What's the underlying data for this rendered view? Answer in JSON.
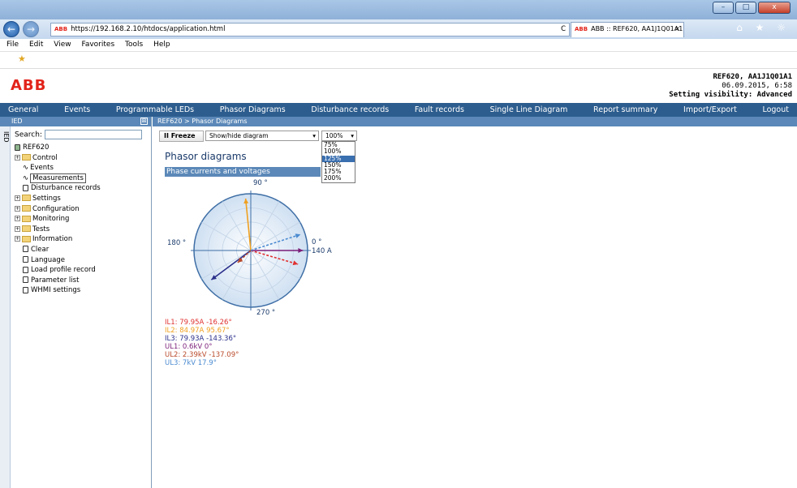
{
  "browser": {
    "url": "https://192.168.2.10/htdocs/application.html",
    "tab_title": "ABB :: REF620, AA1J1Q01A1...",
    "tab_close": "×",
    "win_minimize": "–",
    "win_restore": "□",
    "win_close": "x",
    "abb_badge": "ABB",
    "back": "←",
    "forward": "→",
    "refresh": "C",
    "menus": [
      "File",
      "Edit",
      "View",
      "Favorites",
      "Tools",
      "Help"
    ],
    "toolbar_icons": "⌂ ★ ☼",
    "favorites_star": "★"
  },
  "header": {
    "logo": "ABB",
    "device": "REF620, AA1J1Q01A1",
    "datetime": "06.09.2015, 6:58",
    "visibility": "Setting visibility: Advanced"
  },
  "nav": [
    "General",
    "Events",
    "Programmable LEDs",
    "Phasor Diagrams",
    "Disturbance records",
    "Fault records",
    "Single Line Diagram",
    "Report summary",
    "Import/Export",
    "Logout"
  ],
  "sidebar": {
    "header": "IED",
    "vertical_tab": "IED",
    "search_label": "Search:",
    "search_value": "",
    "collapse": "⊠",
    "tree": [
      {
        "label": "REF620",
        "kind": "root"
      },
      {
        "label": "Control",
        "kind": "folder"
      },
      {
        "label": "Events",
        "kind": "wave"
      },
      {
        "label": "Measurements",
        "kind": "wave-selected"
      },
      {
        "label": "Disturbance records",
        "kind": "leaf"
      },
      {
        "label": "Settings",
        "kind": "folder"
      },
      {
        "label": "Configuration",
        "kind": "folder"
      },
      {
        "label": "Monitoring",
        "kind": "folder"
      },
      {
        "label": "Tests",
        "kind": "folder"
      },
      {
        "label": "Information",
        "kind": "folder"
      },
      {
        "label": "Clear",
        "kind": "leaf"
      },
      {
        "label": "Language",
        "kind": "leaf"
      },
      {
        "label": "Load profile record",
        "kind": "leaf"
      },
      {
        "label": "Parameter list",
        "kind": "leaf"
      },
      {
        "label": "WHMI settings",
        "kind": "leaf"
      }
    ]
  },
  "breadcrumb": "REF620 > Phasor Diagrams",
  "toolbar": {
    "freeze_label": "Freeze",
    "freeze_icon": "II",
    "diagram_select": "Show/hide diagram",
    "zoom_select": "100%",
    "zoom_options": [
      "75%",
      "100%",
      "125%",
      "150%",
      "175%",
      "200%"
    ],
    "zoom_highlight": "125%"
  },
  "page": {
    "title": "Phasor diagrams",
    "section": "Phase currents and voltages",
    "angle_labels": {
      "top": "90 °",
      "left": "180 °",
      "right": "0 °",
      "bottom": "270 °"
    },
    "scale_label": "140 A"
  },
  "readings": [
    {
      "text": "IL1: 79.95A -16.26°",
      "color": "#e03030"
    },
    {
      "text": "IL2: 84.97A 95.67°",
      "color": "#f0a020"
    },
    {
      "text": "IL3: 79.93A -143.36°",
      "color": "#2a2f8a"
    },
    {
      "text": "UL1: 0.6kV 0°",
      "color": "#7a1e78"
    },
    {
      "text": "UL2: 2.39kV -137.09°",
      "color": "#b94a2a"
    },
    {
      "text": "UL3: 7kV 17.9°",
      "color": "#4a8ad0"
    }
  ],
  "phasors": [
    {
      "name": "IL1",
      "magnitude": 79.95,
      "angle": -16.26,
      "unit": "A",
      "color": "#e03030",
      "dashed": true
    },
    {
      "name": "IL2",
      "magnitude": 84.97,
      "angle": 95.67,
      "unit": "A",
      "color": "#f0a020",
      "dashed": false
    },
    {
      "name": "IL3",
      "magnitude": 79.93,
      "angle": -143.36,
      "unit": "A",
      "color": "#2a2f8a",
      "dashed": false
    },
    {
      "name": "UL1",
      "magnitude": 0.6,
      "angle": 0,
      "unit": "kV",
      "color": "#7a1e78",
      "dashed": false
    },
    {
      "name": "UL2",
      "magnitude": 2.39,
      "angle": -137.09,
      "unit": "kV",
      "color": "#b94a2a",
      "dashed": true
    },
    {
      "name": "UL3",
      "magnitude": 7,
      "angle": 17.9,
      "unit": "kV",
      "color": "#4a8ad0",
      "dashed": true
    }
  ]
}
